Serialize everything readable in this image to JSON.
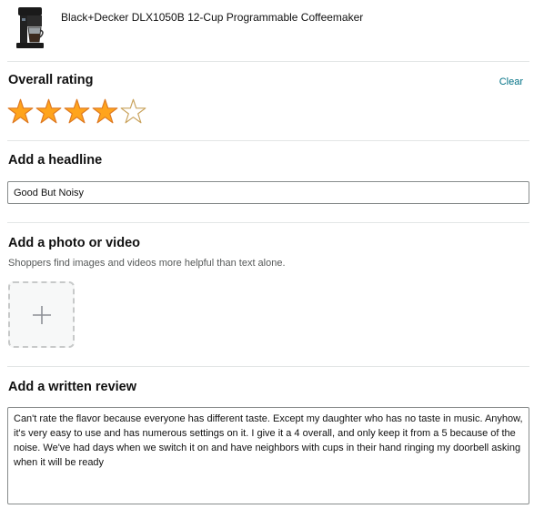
{
  "product": {
    "title": "Black+Decker DLX1050B 12-Cup Programmable Coffeemaker",
    "image_icon": "coffeemaker-image"
  },
  "rating": {
    "title": "Overall rating",
    "clear_label": "Clear",
    "value": 4,
    "max": 5,
    "star_color": "#ffa41c",
    "star_outline_color": "#de7921"
  },
  "headline": {
    "title": "Add a headline",
    "value": "Good But Noisy"
  },
  "media": {
    "title": "Add a photo or video",
    "subtext": "Shoppers find images and videos more helpful than text alone.",
    "upload_icon": "plus-icon"
  },
  "review": {
    "title": "Add a written review",
    "value": "Can't rate the flavor because everyone has different taste. Except my daughter who has no taste in music. Anyhow, it's very easy to use and has numerous settings on it. I give it a 4 overall, and only keep it from a 5 because of the noise. We've had days when we switch it on and have neighbors with cups in their hand ringing my doorbell asking when it will be ready"
  },
  "colors": {
    "link": "#007185",
    "divider": "#e3e6e6"
  }
}
